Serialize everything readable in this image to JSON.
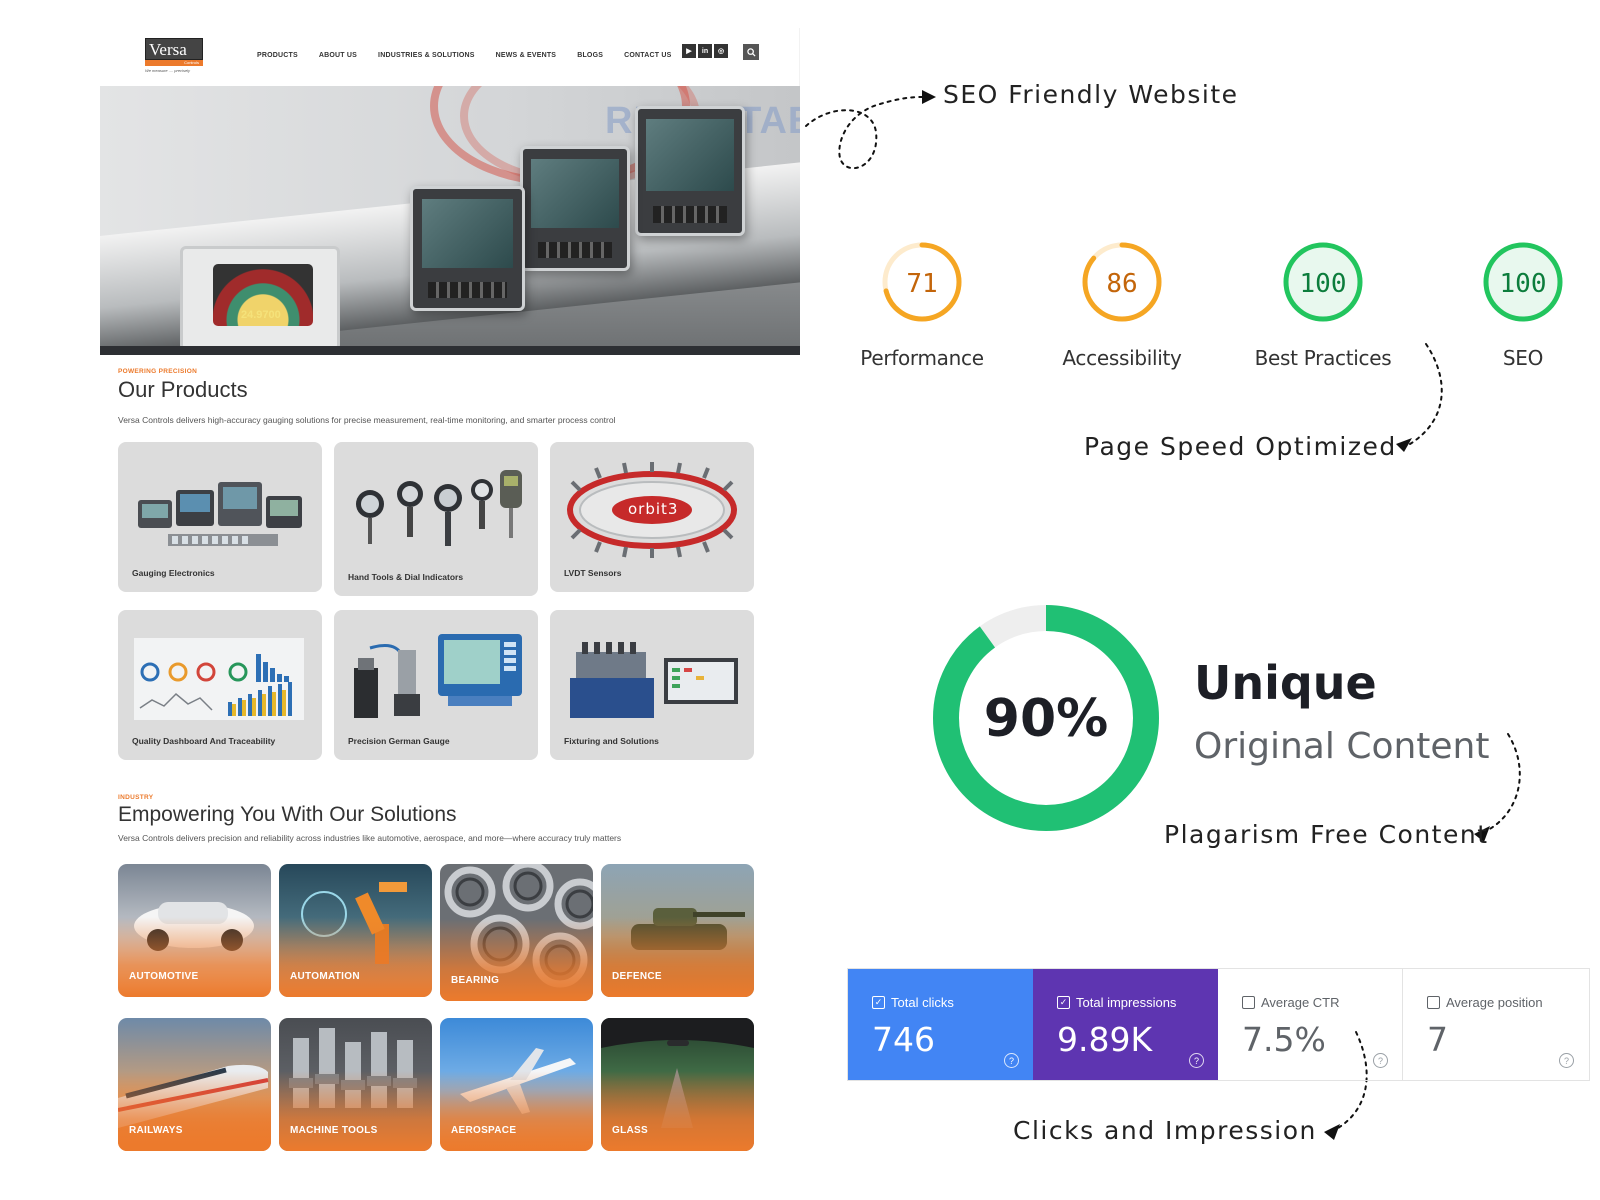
{
  "site": {
    "logo": {
      "name": "Versa",
      "sub": "Controls",
      "tagline": "We measure .... precisely"
    },
    "nav": [
      "PRODUCTS",
      "ABOUT US",
      "INDUSTRIES & SOLUTIONS",
      "NEWS & EVENTS",
      "BLOGS",
      "CONTACT US"
    ],
    "social": [
      "youtube-icon",
      "linkedin-icon",
      "instagram-icon"
    ],
    "hero": {
      "backdrop_text": "REPEATABILITY",
      "readout": "24.9700"
    },
    "products": {
      "eyebrow": "POWERING PRECISION",
      "title": "Our Products",
      "description": "Versa Controls delivers high-accuracy gauging solutions for precise measurement, real-time monitoring, and smarter process control",
      "items": [
        "Gauging Electronics",
        "Hand Tools & Dial Indicators",
        "LVDT Sensors",
        "Quality Dashboard And Traceability",
        "Precision German Gauge",
        "Fixturing and Solutions"
      ],
      "orbit_logo": "orbit3"
    },
    "industry": {
      "eyebrow": "INDUSTRY",
      "title": "Empowering You With Our Solutions",
      "description": "Versa Controls delivers precision and reliability across industries like automotive, aerospace, and more—where accuracy truly matters",
      "items": [
        "AUTOMOTIVE",
        "AUTOMATION",
        "BEARING",
        "DEFENCE",
        "RAILWAYS",
        "MACHINE TOOLS",
        "AEROSPACE",
        "GLASS"
      ]
    }
  },
  "annotations": {
    "seo": "SEO Friendly Website",
    "speed": "Page Speed Optimized",
    "plagiarism": "Plagarism Free Content",
    "clicks": "Clicks and Impression"
  },
  "lighthouse": [
    {
      "score": "71",
      "label": "Performance",
      "value": 71,
      "color": "#f5a623"
    },
    {
      "score": "86",
      "label": "Accessibility",
      "value": 86,
      "color": "#f5a623"
    },
    {
      "score": "100",
      "label": "Best Practices",
      "value": 100,
      "color": "#22c55e"
    },
    {
      "score": "100",
      "label": "SEO",
      "value": 100,
      "color": "#22c55e"
    }
  ],
  "unique": {
    "percent": "90%",
    "value": 90,
    "title": "Unique",
    "subtitle": "Original Content",
    "color": "#20c074"
  },
  "search_console": [
    {
      "label": "Total clicks",
      "value": "746",
      "checked": true
    },
    {
      "label": "Total impressions",
      "value": "9.89K",
      "checked": true
    },
    {
      "label": "Average CTR",
      "value": "7.5%",
      "checked": false
    },
    {
      "label": "Average position",
      "value": "7",
      "checked": false
    }
  ],
  "colors": {
    "brand_orange": "#ec7a2c",
    "clicks_blue": "#4285f4",
    "impressions_purple": "#5e35b1"
  }
}
